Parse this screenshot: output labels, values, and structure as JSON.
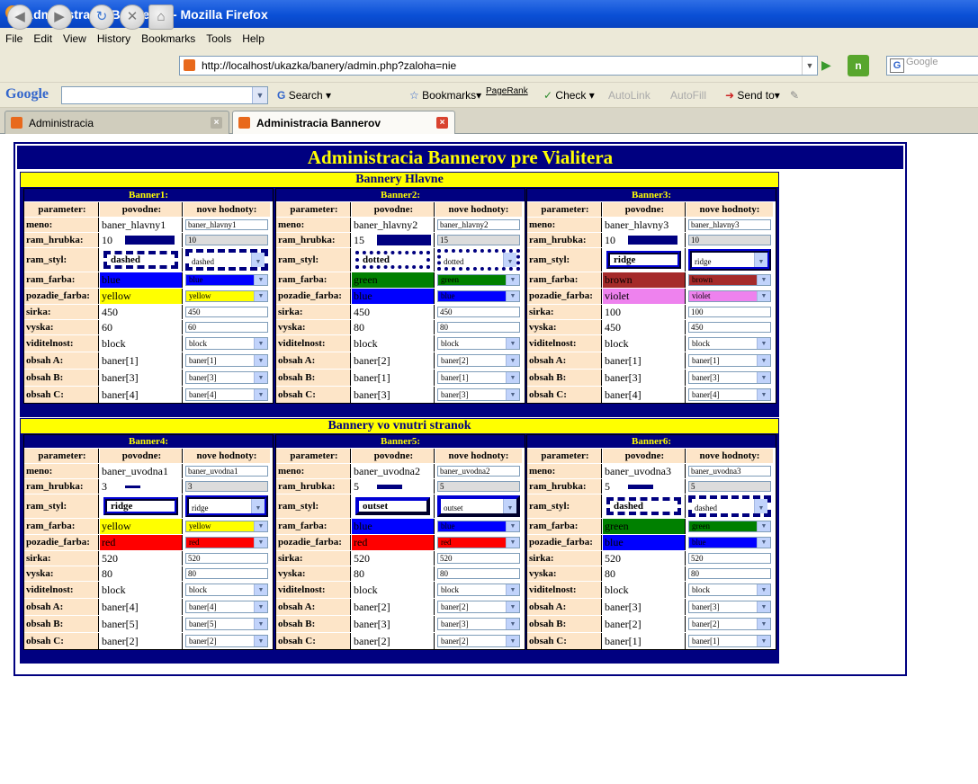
{
  "window": {
    "title": "Administracia Bannerov - Mozilla Firefox"
  },
  "menu": [
    "File",
    "Edit",
    "View",
    "History",
    "Bookmarks",
    "Tools",
    "Help"
  ],
  "nav": {
    "url": "http://localhost/ukazka/banery/admin.php?zaloha=nie",
    "search_placeholder": "Google"
  },
  "googlebar": {
    "logo": "Google",
    "search": "Search",
    "bookmarks": "Bookmarks",
    "pagerank": "PageRank",
    "check": "Check",
    "autolink": "AutoLink",
    "autofill": "AutoFill",
    "sendto": "Send to"
  },
  "tabs": [
    {
      "label": "Administracia"
    },
    {
      "label": "Administracia Bannerov"
    }
  ],
  "page": {
    "title": "Administracia Bannerov pre Vialitera",
    "col_headers": [
      "parameter:",
      "povodne:",
      "nove hodnoty:"
    ],
    "groups": [
      {
        "title": "Bannery Hlavne",
        "banners": [
          {
            "title": "Banner1:",
            "rows": [
              {
                "label": "meno:",
                "old": "baner_hlavny1",
                "new": "baner_hlavny1"
              },
              {
                "label": "ram_hrubka:",
                "old": "10",
                "new": "10"
              },
              {
                "label": "ram_styl:",
                "old": "dashed",
                "new": "dashed"
              },
              {
                "label": "ram_farba:",
                "old": "blue",
                "new": "blue"
              },
              {
                "label": "pozadie_farba:",
                "old": "yellow",
                "new": "yellow"
              },
              {
                "label": "sirka:",
                "old": "450",
                "new": "450"
              },
              {
                "label": "vyska:",
                "old": "60",
                "new": "60"
              },
              {
                "label": "viditelnost:",
                "old": "block",
                "new": "block"
              },
              {
                "label": "obsah A:",
                "old": "baner[1]",
                "new": "baner[1]"
              },
              {
                "label": "obsah B:",
                "old": "baner[3]",
                "new": "baner[3]"
              },
              {
                "label": "obsah C:",
                "old": "baner[4]",
                "new": "baner[4]"
              }
            ]
          },
          {
            "title": "Banner2:",
            "rows": [
              {
                "label": "meno:",
                "old": "baner_hlavny2",
                "new": "baner_hlavny2"
              },
              {
                "label": "ram_hrubka:",
                "old": "15",
                "new": "15"
              },
              {
                "label": "ram_styl:",
                "old": "dotted",
                "new": "dotted"
              },
              {
                "label": "ram_farba:",
                "old": "green",
                "new": "green"
              },
              {
                "label": "pozadie_farba:",
                "old": "blue",
                "new": "blue"
              },
              {
                "label": "sirka:",
                "old": "450",
                "new": "450"
              },
              {
                "label": "vyska:",
                "old": "80",
                "new": "80"
              },
              {
                "label": "viditelnost:",
                "old": "block",
                "new": "block"
              },
              {
                "label": "obsah A:",
                "old": "baner[2]",
                "new": "baner[2]"
              },
              {
                "label": "obsah B:",
                "old": "baner[1]",
                "new": "baner[1]"
              },
              {
                "label": "obsah C:",
                "old": "baner[3]",
                "new": "baner[3]"
              }
            ]
          },
          {
            "title": "Banner3:",
            "rows": [
              {
                "label": "meno:",
                "old": "baner_hlavny3",
                "new": "baner_hlavny3"
              },
              {
                "label": "ram_hrubka:",
                "old": "10",
                "new": "10"
              },
              {
                "label": "ram_styl:",
                "old": "ridge",
                "new": "ridge"
              },
              {
                "label": "ram_farba:",
                "old": "brown",
                "new": "brown"
              },
              {
                "label": "pozadie_farba:",
                "old": "violet",
                "new": "violet"
              },
              {
                "label": "sirka:",
                "old": "100",
                "new": "100"
              },
              {
                "label": "vyska:",
                "old": "450",
                "new": "450"
              },
              {
                "label": "viditelnost:",
                "old": "block",
                "new": "block"
              },
              {
                "label": "obsah A:",
                "old": "baner[1]",
                "new": "baner[1]"
              },
              {
                "label": "obsah B:",
                "old": "baner[3]",
                "new": "baner[3]"
              },
              {
                "label": "obsah C:",
                "old": "baner[4]",
                "new": "baner[4]"
              }
            ]
          }
        ]
      },
      {
        "title": "Bannery vo vnutri stranok",
        "banners": [
          {
            "title": "Banner4:",
            "rows": [
              {
                "label": "meno:",
                "old": "baner_uvodna1",
                "new": "baner_uvodna1"
              },
              {
                "label": "ram_hrubka:",
                "old": "3",
                "new": "3"
              },
              {
                "label": "ram_styl:",
                "old": "ridge",
                "new": "ridge"
              },
              {
                "label": "ram_farba:",
                "old": "yellow",
                "new": "yellow"
              },
              {
                "label": "pozadie_farba:",
                "old": "red",
                "new": "red"
              },
              {
                "label": "sirka:",
                "old": "520",
                "new": "520"
              },
              {
                "label": "vyska:",
                "old": "80",
                "new": "80"
              },
              {
                "label": "viditelnost:",
                "old": "block",
                "new": "block"
              },
              {
                "label": "obsah A:",
                "old": "baner[4]",
                "new": "baner[4]"
              },
              {
                "label": "obsah B:",
                "old": "baner[5]",
                "new": "baner[5]"
              },
              {
                "label": "obsah C:",
                "old": "baner[2]",
                "new": "baner[2]"
              }
            ]
          },
          {
            "title": "Banner5:",
            "rows": [
              {
                "label": "meno:",
                "old": "baner_uvodna2",
                "new": "baner_uvodna2"
              },
              {
                "label": "ram_hrubka:",
                "old": "5",
                "new": "5"
              },
              {
                "label": "ram_styl:",
                "old": "outset",
                "new": "outset"
              },
              {
                "label": "ram_farba:",
                "old": "blue",
                "new": "blue"
              },
              {
                "label": "pozadie_farba:",
                "old": "red",
                "new": "red"
              },
              {
                "label": "sirka:",
                "old": "520",
                "new": "520"
              },
              {
                "label": "vyska:",
                "old": "80",
                "new": "80"
              },
              {
                "label": "viditelnost:",
                "old": "block",
                "new": "block"
              },
              {
                "label": "obsah A:",
                "old": "baner[2]",
                "new": "baner[2]"
              },
              {
                "label": "obsah B:",
                "old": "baner[3]",
                "new": "baner[3]"
              },
              {
                "label": "obsah C:",
                "old": "baner[2]",
                "new": "baner[2]"
              }
            ]
          },
          {
            "title": "Banner6:",
            "rows": [
              {
                "label": "meno:",
                "old": "baner_uvodna3",
                "new": "baner_uvodna3"
              },
              {
                "label": "ram_hrubka:",
                "old": "5",
                "new": "5"
              },
              {
                "label": "ram_styl:",
                "old": "dashed",
                "new": "dashed"
              },
              {
                "label": "ram_farba:",
                "old": "green",
                "new": "green"
              },
              {
                "label": "pozadie_farba:",
                "old": "blue",
                "new": "blue"
              },
              {
                "label": "sirka:",
                "old": "520",
                "new": "520"
              },
              {
                "label": "vyska:",
                "old": "80",
                "new": "80"
              },
              {
                "label": "viditelnost:",
                "old": "block",
                "new": "block"
              },
              {
                "label": "obsah A:",
                "old": "baner[3]",
                "new": "baner[3]"
              },
              {
                "label": "obsah B:",
                "old": "baner[2]",
                "new": "baner[2]"
              },
              {
                "label": "obsah C:",
                "old": "baner[1]",
                "new": "baner[1]"
              }
            ]
          }
        ]
      }
    ]
  },
  "colors": {
    "navy": "#000080",
    "yellow": "#ffff00",
    "label_bg": "#fde5c8",
    "blue": "#0000ff",
    "green": "#008000",
    "red": "#ff0000",
    "brown": "#a52a2a",
    "violet": "#ee82ee"
  }
}
